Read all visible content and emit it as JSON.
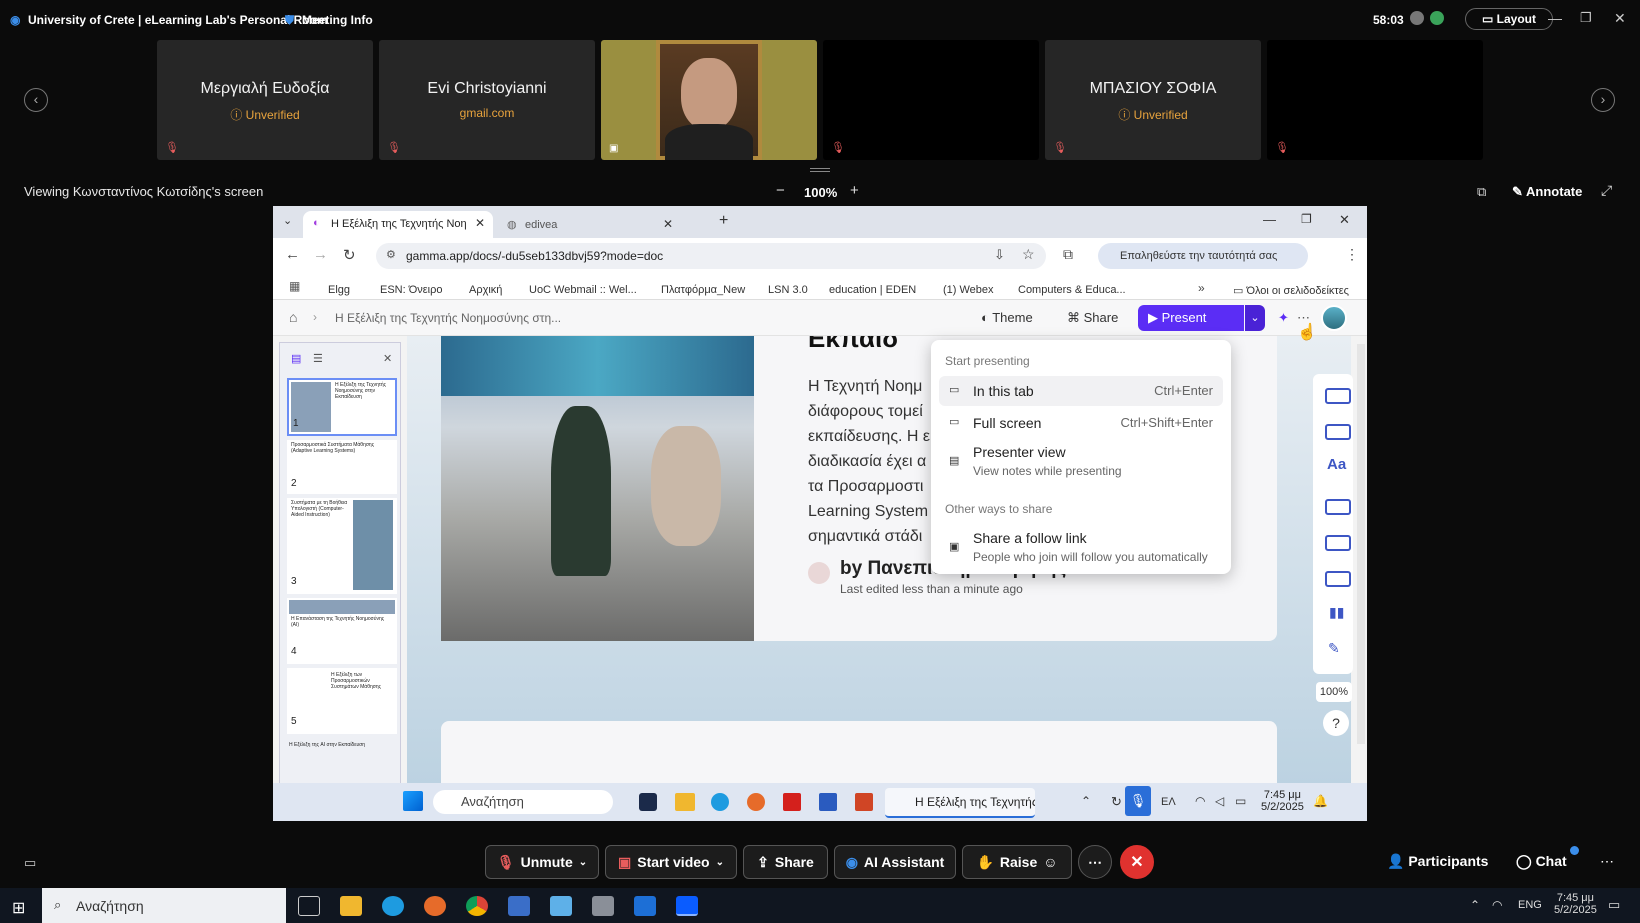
{
  "meeting": {
    "title": "University of Crete | eLearning Lab's Personal Room",
    "meeting_info": "Meeting Info",
    "timer": "58:03",
    "layout_label": "Layout"
  },
  "participants": [
    {
      "name": "Μεργιαλή Ευδοξία",
      "sub": "Unverified"
    },
    {
      "name": "Evi Christoyianni",
      "sub": "gmail.com"
    },
    {
      "name": "",
      "sub": ""
    },
    {
      "name": "",
      "sub": ""
    },
    {
      "name": "ΜΠΑΣΙΟΥ ΣΟΦΙΑ",
      "sub": "Unverified"
    },
    {
      "name": "",
      "sub": ""
    }
  ],
  "viewing": {
    "label": "Viewing Κωνσταντίνος Κωτσίδης's screen",
    "zoom": "100%",
    "annotate": "Annotate"
  },
  "browser": {
    "tab1": "Η Εξέλιξη της Τεχνητής Νοημο",
    "tab2": "edivea",
    "url": "gamma.app/docs/-du5seb133dbvj59?mode=doc",
    "profile": "Επαληθεύστε την ταυτότητά σας",
    "bookmarks": [
      "Elgg",
      "ESN: Όνειρο",
      "Αρχική",
      "UoC Webmail :: Wel...",
      "Πλατφόρμα_New",
      "LSN 3.0",
      "education | EDEN",
      "(1) Webex",
      "Computers & Educa..."
    ],
    "bookmarks_folder": "Όλοι οι σελιδοδείκτες"
  },
  "gamma": {
    "breadcrumb": "Η Εξέλιξη της Τεχνητής Νοημοσύνης στη...",
    "theme": "Theme",
    "share": "Share",
    "present": "Present",
    "heading_partial": "Εκπαίδ",
    "body_lines": [
      "Η Τεχνητή Νοημ",
      "διάφορους τομεί",
      "εκπαίδευσης. Η ε",
      "διαδικασία έχει α",
      "τα Προσαρμοστι",
      "Learning System",
      "σημαντικά στάδι"
    ],
    "author": "by Πανεπιστήμιο Κρήτης ΕΔΙΒΕΑ",
    "edited": "Last edited less than a minute ago",
    "zoom": "100%",
    "help": "?",
    "thumbs": [
      "1",
      "2",
      "3",
      "4",
      "5"
    ],
    "thumb_titles": [
      "Η Εξέλιξη της Τεχνητής Νοημοσύνης στην Εκπαίδευση",
      "Προσαρμοστικά Συστήματα Μάθησης (Adaptive Learning Systems)",
      "Συστήματα με τη Βοήθεια Υπολογιστή (Computer-Aided Instruction)",
      "Η Επανάσταση της Τεχνητής Νοημοσύνης (AI)",
      "Η Εξέλιξη των Προσαρμοστικών Συστημάτων Μάθησης",
      "Η Εξέλιξη της AI στην Εκπαίδευση"
    ]
  },
  "present_menu": {
    "heading1": "Start presenting",
    "items": [
      {
        "label": "In this tab",
        "shortcut": "Ctrl+Enter"
      },
      {
        "label": "Full screen",
        "shortcut": "Ctrl+Shift+Enter"
      },
      {
        "label": "Presenter view",
        "desc": "View notes while presenting"
      }
    ],
    "heading2": "Other ways to share",
    "follow": {
      "label": "Share a follow link",
      "desc": "People who join will follow you automatically"
    }
  },
  "inner_taskbar": {
    "search": "Αναζήτηση",
    "active_app": "Η Εξέλιξη της Τεχνητής",
    "lang": "ΕΛ",
    "time": "7:45 μμ",
    "date": "5/2/2025"
  },
  "controls": {
    "unmute": "Unmute",
    "start_video": "Start video",
    "share": "Share",
    "ai": "AI Assistant",
    "raise": "Raise",
    "participants": "Participants",
    "chat": "Chat"
  },
  "os_taskbar": {
    "search": "Αναζήτηση",
    "lang": "ENG",
    "time": "7:45 μμ",
    "date": "5/2/2025"
  }
}
